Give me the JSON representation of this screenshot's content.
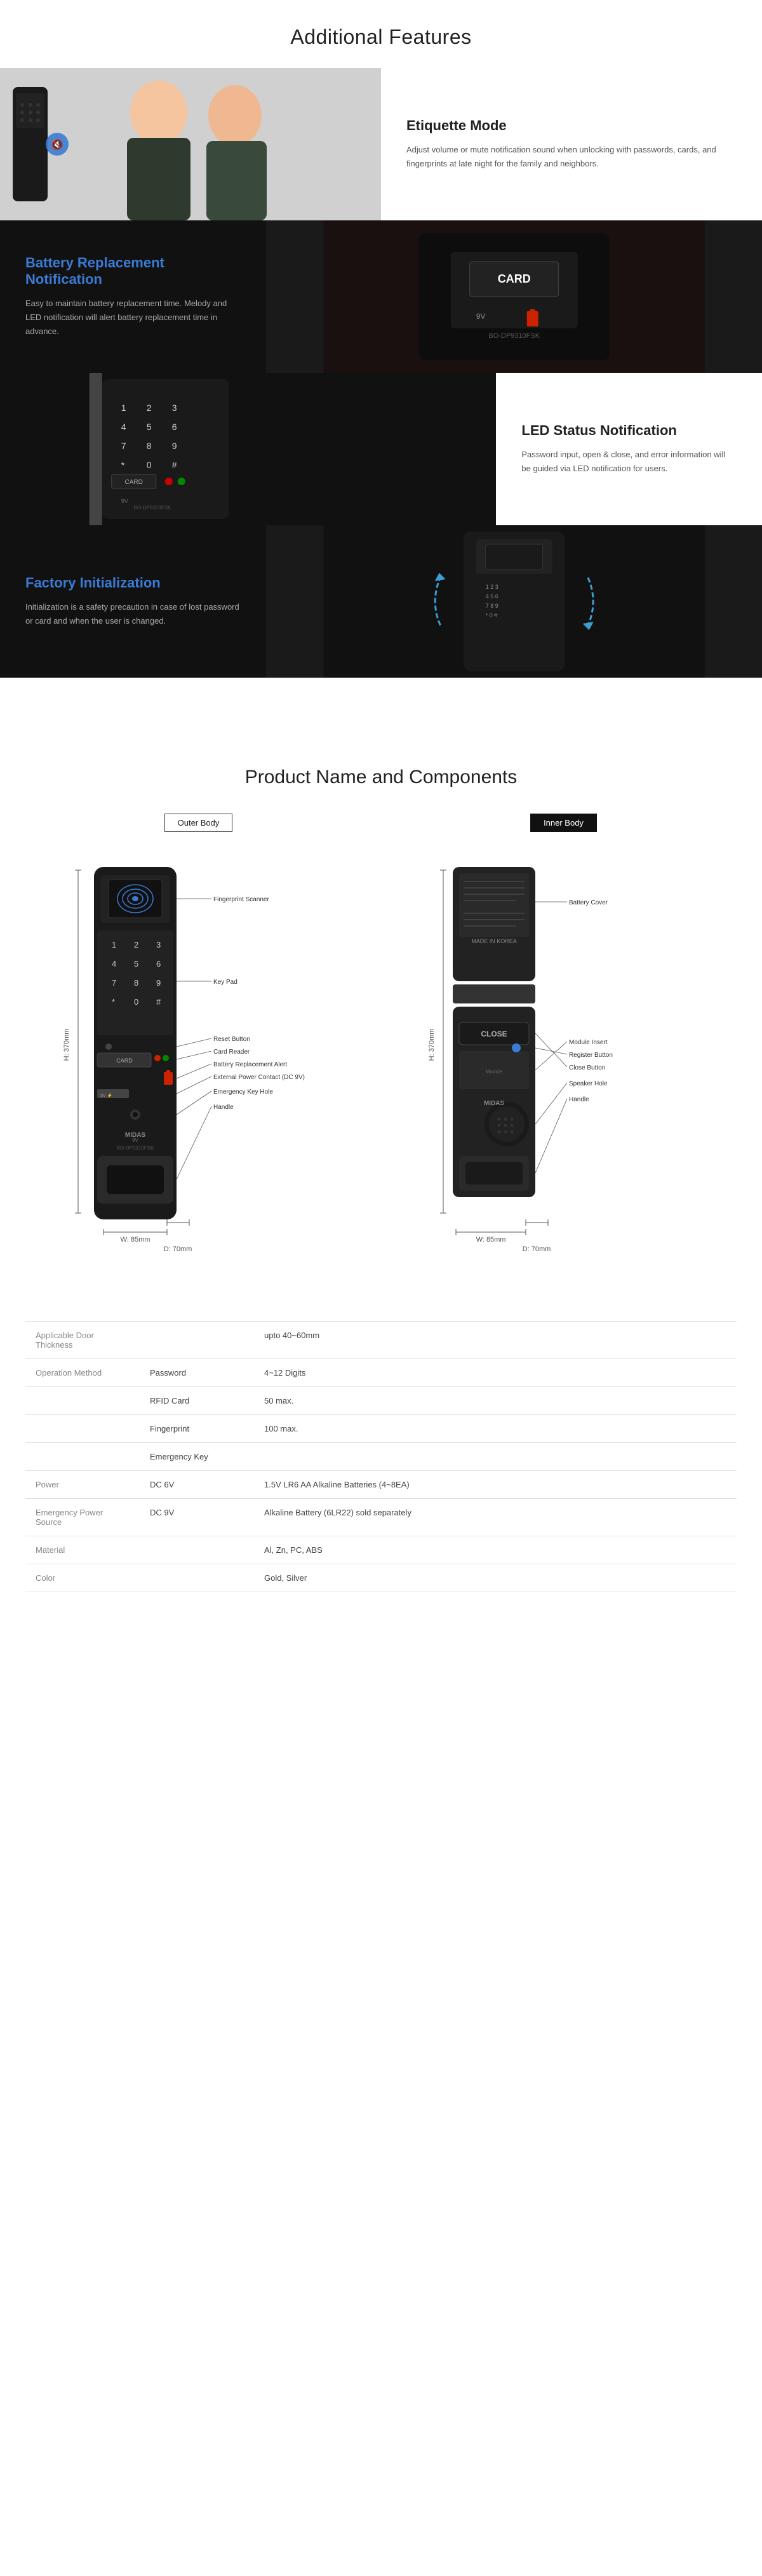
{
  "additionalFeatures": {
    "sectionTitle": "Additional Features",
    "features": [
      {
        "id": "etiquette-mode",
        "title": "Etiquette Mode",
        "titleColor": "dark-text",
        "description": "Adjust volume or mute notification sound when unlocking with\npasswords, cards, and fingerprints at late night for\nthe family and neighbors.",
        "imagePosition": "left",
        "imageSide": "dark"
      },
      {
        "id": "battery-replacement",
        "title": "Battery Replacement Notification",
        "titleColor": "blue",
        "description": "Easy to maintain battery replacement time. Melody and\nLED notification will alert battery replacement time in advance.",
        "imagePosition": "right",
        "imageSide": "light"
      },
      {
        "id": "led-status",
        "title": "LED Status Notification",
        "titleColor": "dark-text",
        "description": "Password input, open & close, and error information will be\nguided via LED notification for users.",
        "imagePosition": "left",
        "imageSide": "dark"
      },
      {
        "id": "factory-initialization",
        "title": "Factory Initialization",
        "titleColor": "blue",
        "description": "Initialization is a safety precaution in case of lost password or\ncard and when the user is changed.",
        "imagePosition": "right",
        "imageSide": "light"
      }
    ]
  },
  "productSection": {
    "title": "Product Name and Components",
    "outerBodyLabel": "Outer Body",
    "innerBodyLabel": "Inner Body",
    "outerAnnotations": [
      {
        "label": "Fingerprint Scanner",
        "side": "right"
      },
      {
        "label": "Key Pad",
        "side": "right"
      },
      {
        "label": "Reset Button",
        "side": "right"
      },
      {
        "label": "Card Reader",
        "side": "right"
      },
      {
        "label": "Battery Replacement Alert",
        "side": "right"
      },
      {
        "label": "External Power Contact (DC 9V)",
        "side": "right"
      },
      {
        "label": "Emergency Key Hole",
        "side": "right"
      },
      {
        "label": "Handle",
        "side": "right"
      }
    ],
    "innerAnnotations": [
      {
        "label": "Battery Cover",
        "side": "right"
      },
      {
        "label": "Module Insert",
        "side": "right"
      },
      {
        "label": "Register Button",
        "side": "right"
      },
      {
        "label": "Close Button",
        "side": "right"
      },
      {
        "label": "Speaker Hole",
        "side": "right"
      },
      {
        "label": "Handle",
        "side": "right"
      }
    ],
    "outerDimensions": {
      "height": "H: 370mm",
      "depth": "D: 70mm",
      "width": "W: 85mm"
    },
    "innerDimensions": {
      "height": "H: 370mm",
      "depth": "D: 70mm",
      "width": "W: 85mm"
    }
  },
  "specTable": {
    "rows": [
      {
        "category": "Applicable Door Thickness",
        "key": "",
        "value": "upto 40~60mm"
      },
      {
        "category": "Operation Method",
        "key": "Password",
        "value": "4~12 Digits"
      },
      {
        "category": "",
        "key": "RFID Card",
        "value": "50 max."
      },
      {
        "category": "",
        "key": "Fingerprint",
        "value": "100 max."
      },
      {
        "category": "",
        "key": "Emergency Key",
        "value": ""
      },
      {
        "category": "Power",
        "key": "DC 6V",
        "value": "1.5V LR6 AA Alkaline Batteries (4~8EA)"
      },
      {
        "category": "Emergency Power Source",
        "key": "DC 9V",
        "value": "Alkaline Battery (6LR22) sold separately"
      },
      {
        "category": "Material",
        "key": "",
        "value": "Al, Zn, PC, ABS"
      },
      {
        "category": "Color",
        "key": "",
        "value": "Gold, Silver"
      }
    ]
  }
}
